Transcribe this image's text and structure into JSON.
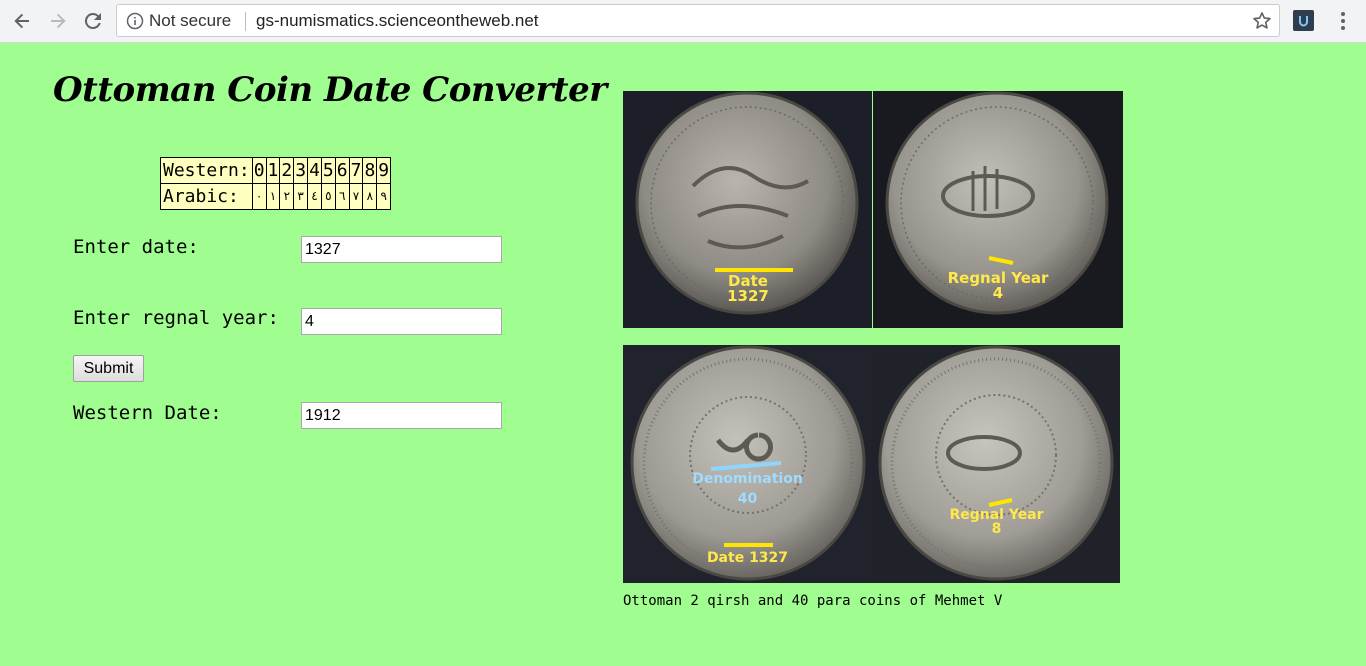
{
  "browser": {
    "security_label": "Not secure",
    "url": "gs-numismatics.scienceontheweb.net"
  },
  "page": {
    "title": "Ottoman Coin Date Converter"
  },
  "digit_table": {
    "western_label": "Western:",
    "arabic_label": "Arabic:",
    "western_digits": [
      "0",
      "1",
      "2",
      "3",
      "4",
      "5",
      "6",
      "7",
      "8",
      "9"
    ],
    "arabic_digits": [
      "٠",
      "١",
      "٢",
      "٣",
      "٤",
      "٥",
      "٦",
      "٧",
      "٨",
      "٩"
    ]
  },
  "form": {
    "date_label": "Enter date:",
    "date_value": "1327",
    "regnal_label": "Enter regnal year:",
    "regnal_value": "4",
    "submit_label": "Submit",
    "western_label": "Western Date:",
    "western_value": "1912"
  },
  "images": {
    "top_left": {
      "label": "Date",
      "value": "1327"
    },
    "top_right": {
      "label": "Regnal Year",
      "value": "4"
    },
    "bottom_left": {
      "label": "Denomination",
      "value": "40",
      "date_label": "Date 1327"
    },
    "bottom_right": {
      "label": "Regnal Year",
      "value": "8"
    },
    "caption": "Ottoman 2 qirsh and 40 para coins of Mehmet V"
  }
}
